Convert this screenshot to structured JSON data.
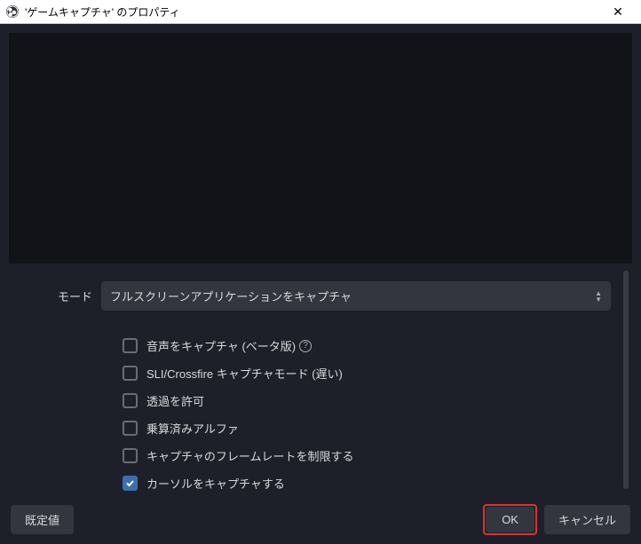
{
  "titlebar": {
    "title": "'ゲームキャプチャ' のプロパティ"
  },
  "form": {
    "mode_label": "モード",
    "mode_value": "フルスクリーンアプリケーションをキャプチャ"
  },
  "checkboxes": {
    "audio": {
      "label": "音声をキャプチャ (ベータ版)",
      "checked": false
    },
    "sli": {
      "label": "SLI/Crossfire キャプチャモード (遅い)",
      "checked": false
    },
    "transparent": {
      "label": "透過を許可",
      "checked": false
    },
    "premult": {
      "label": "乗算済みアルファ",
      "checked": false
    },
    "limitfps": {
      "label": "キャプチャのフレームレートを制限する",
      "checked": false
    },
    "cursor": {
      "label": "カーソルをキャプチャする",
      "checked": true
    }
  },
  "footer": {
    "defaults": "既定値",
    "ok": "OK",
    "cancel": "キャンセル"
  }
}
